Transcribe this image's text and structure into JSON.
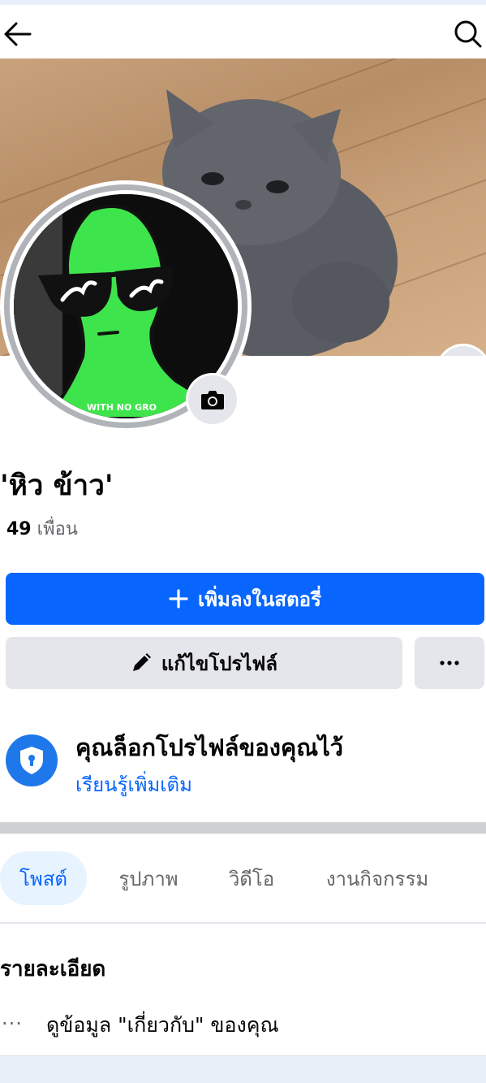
{
  "profile": {
    "name": "'หิว ข้าว'",
    "friends_count": "49",
    "friends_label": "เพื่อน",
    "avatar_caption": "WITH NO GRO"
  },
  "actions": {
    "add_story_label": "เพิ่มลงในสตอรี่",
    "edit_profile_label": "แก้ไขโปรไฟล์",
    "more_label": "···"
  },
  "lock_notice": {
    "title": "คุณล็อกโปรไฟล์ของคุณไว้",
    "link": "เรียนรู้เพิ่มเติม"
  },
  "tabs": [
    {
      "label": "โพสต์",
      "active": true
    },
    {
      "label": "รูปภาพ",
      "active": false
    },
    {
      "label": "วิดีโอ",
      "active": false
    },
    {
      "label": "งานกิจกรรม",
      "active": false
    }
  ],
  "details": {
    "title": "รายละเอียด",
    "about_text": "ดูข้อมูล \"เกี่ยวกับ\" ของคุณ",
    "about_dots": "···"
  },
  "colors": {
    "primary": "#0866ff",
    "button_gray": "#e4e6eb",
    "tab_active_bg": "#e7f3ff",
    "avatar_green": "#3ee44b"
  },
  "icons": {
    "back": "arrow-left",
    "search": "magnifier",
    "camera": "camera",
    "plus": "plus",
    "edit": "pencil",
    "lock": "shield-lock"
  }
}
